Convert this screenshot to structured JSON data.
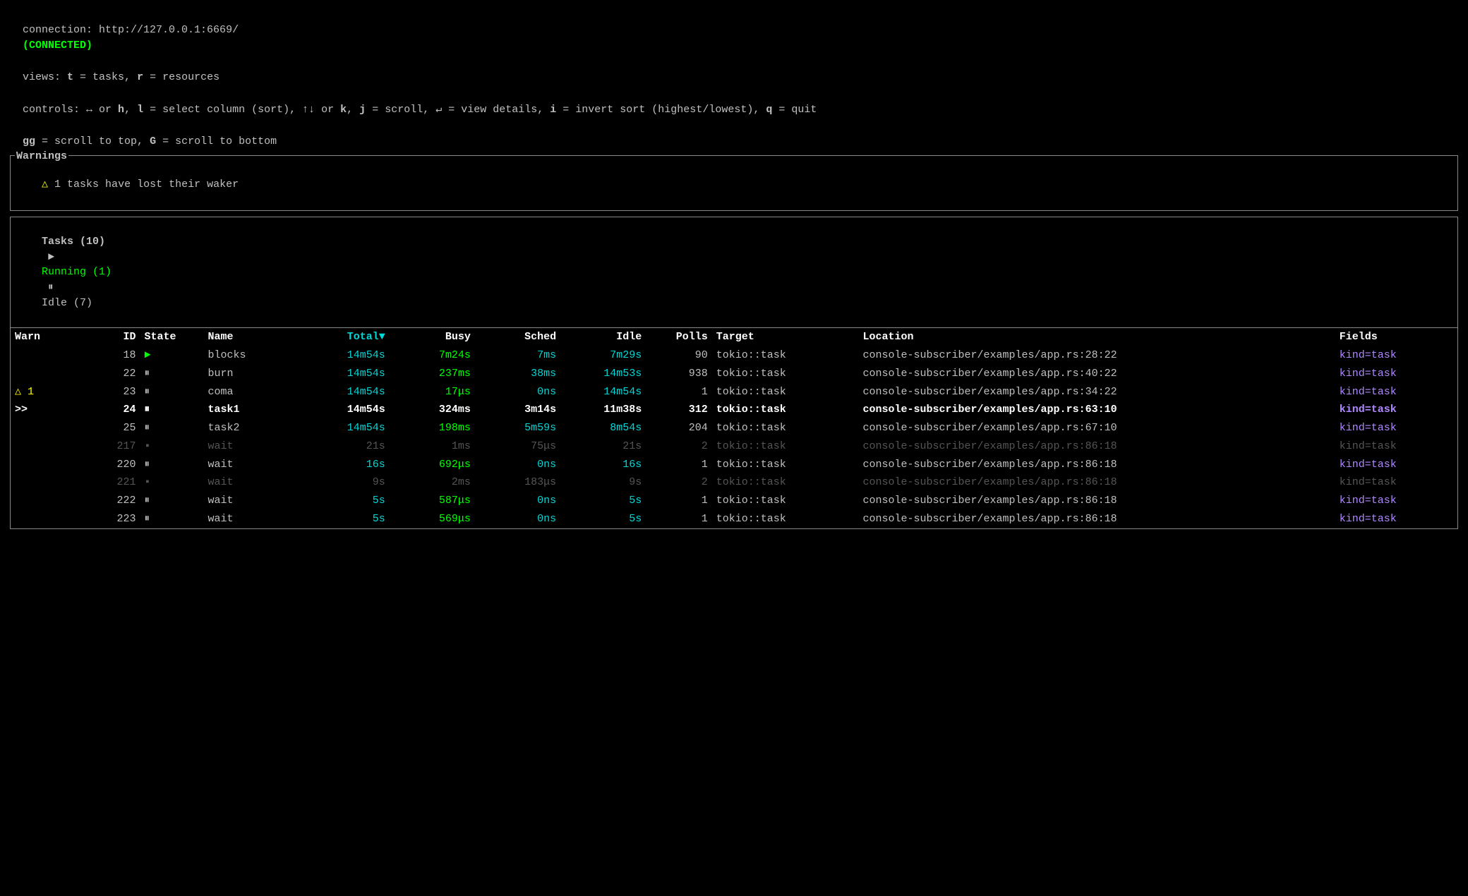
{
  "connection": {
    "label": "connection: http://127.0.0.1:6669/",
    "status": "(CONNECTED)"
  },
  "views_line": "views: t = tasks, r = resources",
  "controls_line": "controls: ↔ or h, l = select column (sort), ↑↓ or k, j = scroll, ↵ = view details, i = invert sort (highest/lowest), q = quit",
  "scroll_line": "gg = scroll to top, G = scroll to bottom",
  "warnings": {
    "title": "Warnings",
    "items": [
      "△ 1 tasks have lost their waker"
    ]
  },
  "tasks": {
    "title": "Tasks (10)",
    "running": "Running (1)",
    "idle": "Idle (7)",
    "columns": [
      "Warn",
      "ID",
      "State",
      "Name",
      "Total▼",
      "Busy",
      "Sched",
      "Idle",
      "Polls",
      "Target",
      "Location",
      "Fields"
    ],
    "rows": [
      {
        "warn": "",
        "id": "18",
        "state": "►",
        "name": "blocks",
        "total": "14m54s",
        "busy": "7m24s",
        "sched": "7ms",
        "idle": "7m29s",
        "polls": "90",
        "target": "tokio::task",
        "location": "console-subscriber/examples/app.rs:28:22",
        "fields": "kind=task",
        "selected": false,
        "dimmed": false,
        "warn_triangle": false
      },
      {
        "warn": "",
        "id": "22",
        "state": "⏸",
        "name": "burn",
        "total": "14m54s",
        "busy": "237ms",
        "sched": "38ms",
        "idle": "14m53s",
        "polls": "938",
        "target": "tokio::task",
        "location": "console-subscriber/examples/app.rs:40:22",
        "fields": "kind=task",
        "selected": false,
        "dimmed": false,
        "warn_triangle": false
      },
      {
        "warn": "△ 1",
        "id": "23",
        "state": "⏸",
        "name": "coma",
        "total": "14m54s",
        "busy": "17μs",
        "sched": "0ns",
        "idle": "14m54s",
        "polls": "1",
        "target": "tokio::task",
        "location": "console-subscriber/examples/app.rs:34:22",
        "fields": "kind=task",
        "selected": false,
        "dimmed": false,
        "warn_triangle": true
      },
      {
        "warn": "",
        "id": "24",
        "state": "⏸",
        "name": "task1",
        "total": "14m54s",
        "busy": "324ms",
        "sched": "3m14s",
        "idle": "11m38s",
        "polls": "312",
        "target": "tokio::task",
        "location": "console-subscriber/examples/app.rs:63:10",
        "fields": "kind=task",
        "selected": true,
        "dimmed": false,
        "warn_triangle": false
      },
      {
        "warn": "",
        "id": "25",
        "state": "⏸",
        "name": "task2",
        "total": "14m54s",
        "busy": "198ms",
        "sched": "5m59s",
        "idle": "8m54s",
        "polls": "204",
        "target": "tokio::task",
        "location": "console-subscriber/examples/app.rs:67:10",
        "fields": "kind=task",
        "selected": false,
        "dimmed": false,
        "warn_triangle": false
      },
      {
        "warn": "",
        "id": "217",
        "state": "▪",
        "name": "wait",
        "total": "21s",
        "busy": "1ms",
        "sched": "75μs",
        "idle": "21s",
        "polls": "2",
        "target": "tokio::task",
        "location": "console-subscriber/examples/app.rs:86:18",
        "fields": "kind=task",
        "selected": false,
        "dimmed": true,
        "warn_triangle": false
      },
      {
        "warn": "",
        "id": "220",
        "state": "⏸",
        "name": "wait",
        "total": "16s",
        "busy": "692μs",
        "sched": "0ns",
        "idle": "16s",
        "polls": "1",
        "target": "tokio::task",
        "location": "console-subscriber/examples/app.rs:86:18",
        "fields": "kind=task",
        "selected": false,
        "dimmed": false,
        "warn_triangle": false
      },
      {
        "warn": "",
        "id": "221",
        "state": "▪",
        "name": "wait",
        "total": "9s",
        "busy": "2ms",
        "sched": "183μs",
        "idle": "9s",
        "polls": "2",
        "target": "tokio::task",
        "location": "console-subscriber/examples/app.rs:86:18",
        "fields": "kind=task",
        "selected": false,
        "dimmed": true,
        "warn_triangle": false
      },
      {
        "warn": "",
        "id": "222",
        "state": "⏸",
        "name": "wait",
        "total": "5s",
        "busy": "587μs",
        "sched": "0ns",
        "idle": "5s",
        "polls": "1",
        "target": "tokio::task",
        "location": "console-subscriber/examples/app.rs:86:18",
        "fields": "kind=task",
        "selected": false,
        "dimmed": false,
        "warn_triangle": false
      },
      {
        "warn": "",
        "id": "223",
        "state": "⏸",
        "name": "wait",
        "total": "5s",
        "busy": "569μs",
        "sched": "0ns",
        "idle": "5s",
        "polls": "1",
        "target": "tokio::task",
        "location": "console-subscriber/examples/app.rs:86:18",
        "fields": "kind=task",
        "selected": false,
        "dimmed": false,
        "warn_triangle": false
      }
    ]
  }
}
